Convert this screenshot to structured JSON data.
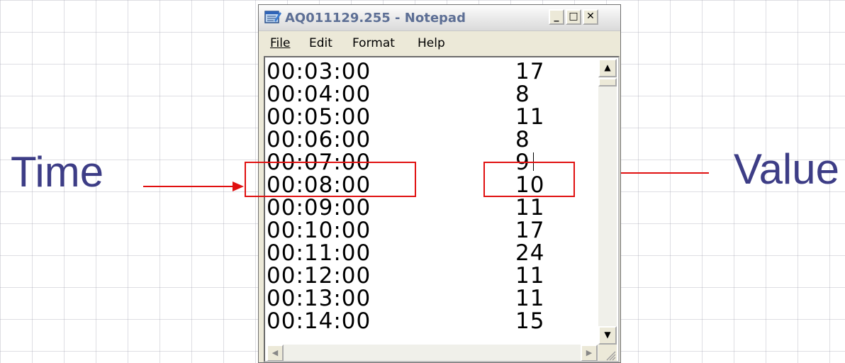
{
  "annotations": {
    "time_label": "Time",
    "value_label": "Value",
    "highlight_color": "#e01010",
    "label_color": "#3d3d86"
  },
  "window": {
    "title": "AQ011129.255 - Notepad",
    "app_icon": "notepad-icon",
    "controls": [
      "minimize-icon",
      "maximize-icon",
      "close-icon"
    ]
  },
  "menu": {
    "file": "File",
    "edit": "Edit",
    "format": "Format",
    "help": "Help"
  },
  "lines": [
    {
      "time": "00:03:00",
      "value": "17"
    },
    {
      "time": "00:04:00",
      "value": "8"
    },
    {
      "time": "00:05:00",
      "value": "11"
    },
    {
      "time": "00:06:00",
      "value": "8"
    },
    {
      "time": "00:07:00",
      "value": "9"
    },
    {
      "time": "00:08:00",
      "value": "10"
    },
    {
      "time": "00:09:00",
      "value": "11"
    },
    {
      "time": "00:10:00",
      "value": "17"
    },
    {
      "time": "00:11:00",
      "value": "24"
    },
    {
      "time": "00:12:00",
      "value": "11"
    },
    {
      "time": "00:13:00",
      "value": "11"
    },
    {
      "time": "00:14:00",
      "value": "15"
    }
  ]
}
